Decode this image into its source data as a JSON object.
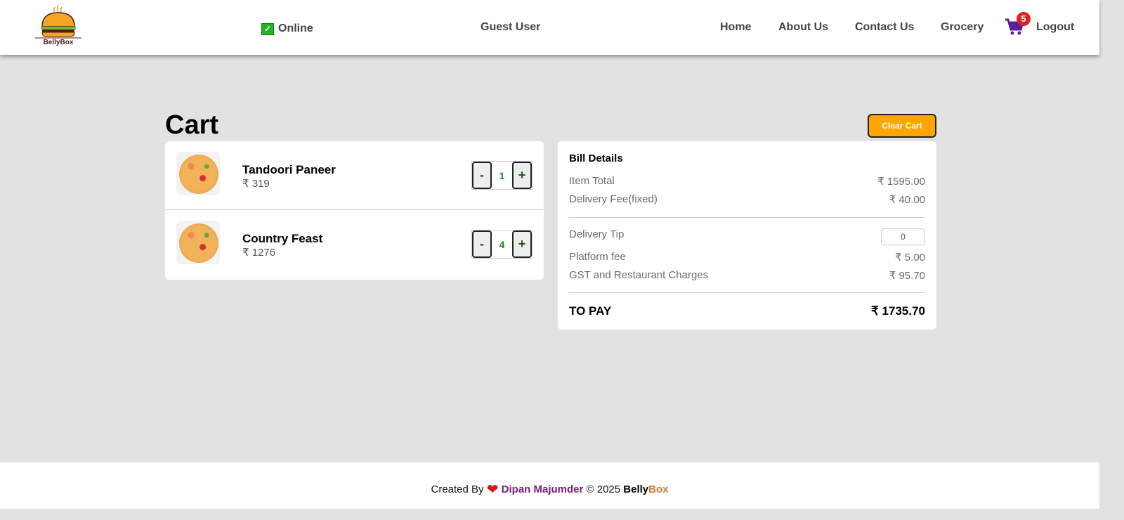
{
  "header": {
    "logo_text": "BellyBox",
    "status": "Online",
    "user": "Guest User",
    "nav": [
      "Home",
      "About Us",
      "Contact Us",
      "Grocery"
    ],
    "cart_count": "5",
    "logout": "Logout"
  },
  "cart": {
    "title": "Cart",
    "clear_label": "Clear Cart",
    "items": [
      {
        "name": "Tandoori Paneer",
        "price": "₹ 319",
        "qty": "1"
      },
      {
        "name": "Country Feast",
        "price": "₹ 1276",
        "qty": "4"
      }
    ],
    "minus": "-",
    "plus": "+"
  },
  "bill": {
    "title": "Bill Details",
    "item_total_label": "Item Total",
    "item_total": "₹ 1595.00",
    "delivery_label": "Delivery Fee(fixed)",
    "delivery": "₹ 40.00",
    "tip_label": "Delivery Tip",
    "tip_value": "0",
    "platform_label": "Platform fee",
    "platform": "₹ 5.00",
    "gst_label": "GST and Restaurant Charges",
    "gst": "₹ 95.70",
    "to_pay_label": "TO PAY",
    "to_pay": "₹ 1735.70"
  },
  "footer": {
    "created_by": "Created By",
    "author": "Dipan Majumder",
    "copyright": "© 2025",
    "brand_a": "Belly",
    "brand_b": "Box"
  },
  "colors": {
    "accent": "#ffa500",
    "cart": "#5a1fa0",
    "badge": "#dd2222"
  }
}
